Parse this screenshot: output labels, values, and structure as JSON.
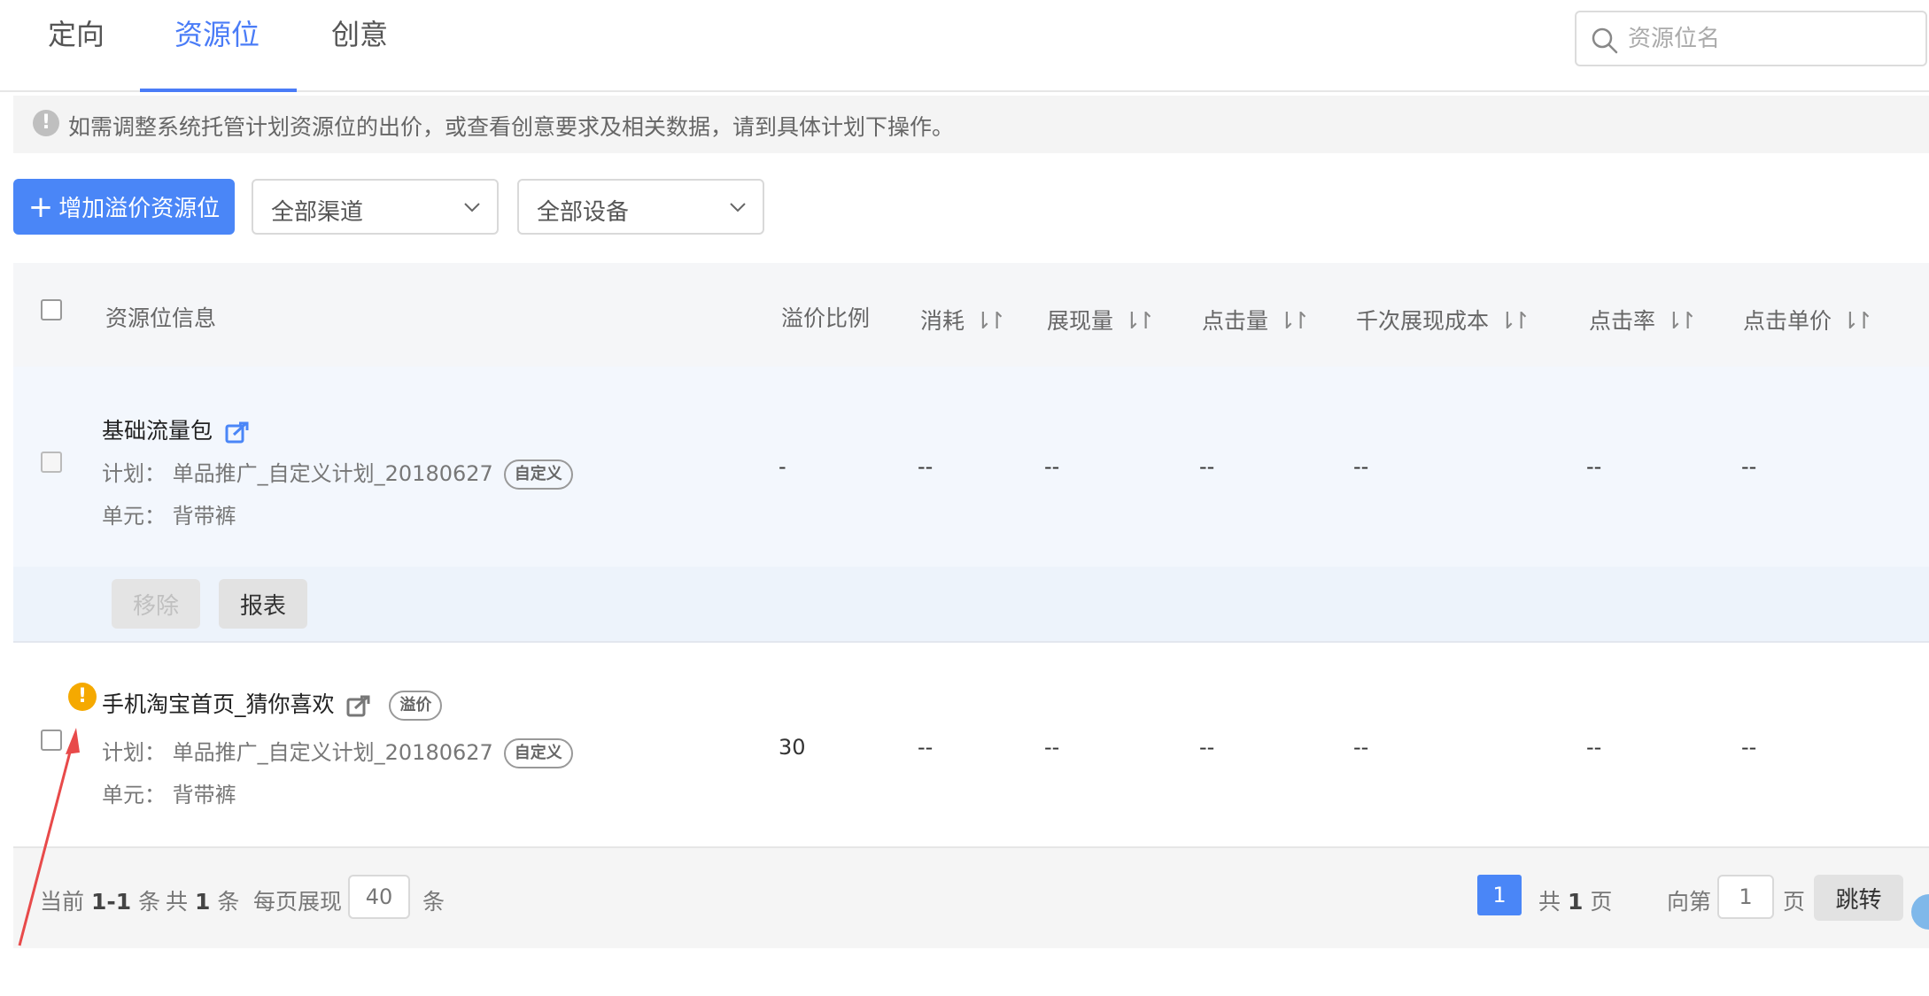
{
  "tabs": [
    {
      "label": "定向"
    },
    {
      "label": "资源位"
    },
    {
      "label": "创意"
    }
  ],
  "search": {
    "placeholder": "资源位名"
  },
  "notice": {
    "text": "如需调整系统托管计划资源位的出价，或查看创意要求及相关数据，请到具体计划下操作。"
  },
  "toolbar": {
    "add_button": "增加溢价资源位",
    "channel_select": "全部渠道",
    "device_select": "全部设备"
  },
  "table": {
    "headers": {
      "info": "资源位信息",
      "premium": "溢价比例",
      "cost": "消耗",
      "impressions": "展现量",
      "clicks": "点击量",
      "cpm": "千次展现成本",
      "ctr": "点击率",
      "cpc": "点击单价"
    },
    "rows": [
      {
        "name": "基础流量包",
        "plan_label": "计划：",
        "plan": "单品推广_自定义计划_20180627",
        "plan_tag": "自定义",
        "unit_label": "单元：",
        "unit": "背带裤",
        "premium": "-",
        "cost": "--",
        "impressions": "--",
        "clicks": "--",
        "cpm": "--",
        "ctr": "--",
        "cpc": "--",
        "remove_button": "移除",
        "report_button": "报表"
      },
      {
        "name": "手机淘宝首页_猜你喜欢",
        "name_tag": "溢价",
        "plan_label": "计划：",
        "plan": "单品推广_自定义计划_20180627",
        "plan_tag": "自定义",
        "unit_label": "单元：",
        "unit": "背带裤",
        "premium": "30",
        "cost": "--",
        "impressions": "--",
        "clicks": "--",
        "cpm": "--",
        "ctr": "--",
        "cpc": "--"
      }
    ]
  },
  "pagination": {
    "current_prefix": "当前",
    "range": "1-1",
    "item_unit": "条",
    "total_prefix": "共",
    "total": "1",
    "page_size_label": "每页展现",
    "page_size": "40",
    "current_page": "1",
    "pages_total": "1",
    "page_unit": "页",
    "goto_label": "向第",
    "goto_value": "1",
    "jump_button": "跳转"
  },
  "colors": {
    "accent": "#4a86f7",
    "warning": "#f5a900",
    "annotation_arrow": "#e84a4a"
  }
}
